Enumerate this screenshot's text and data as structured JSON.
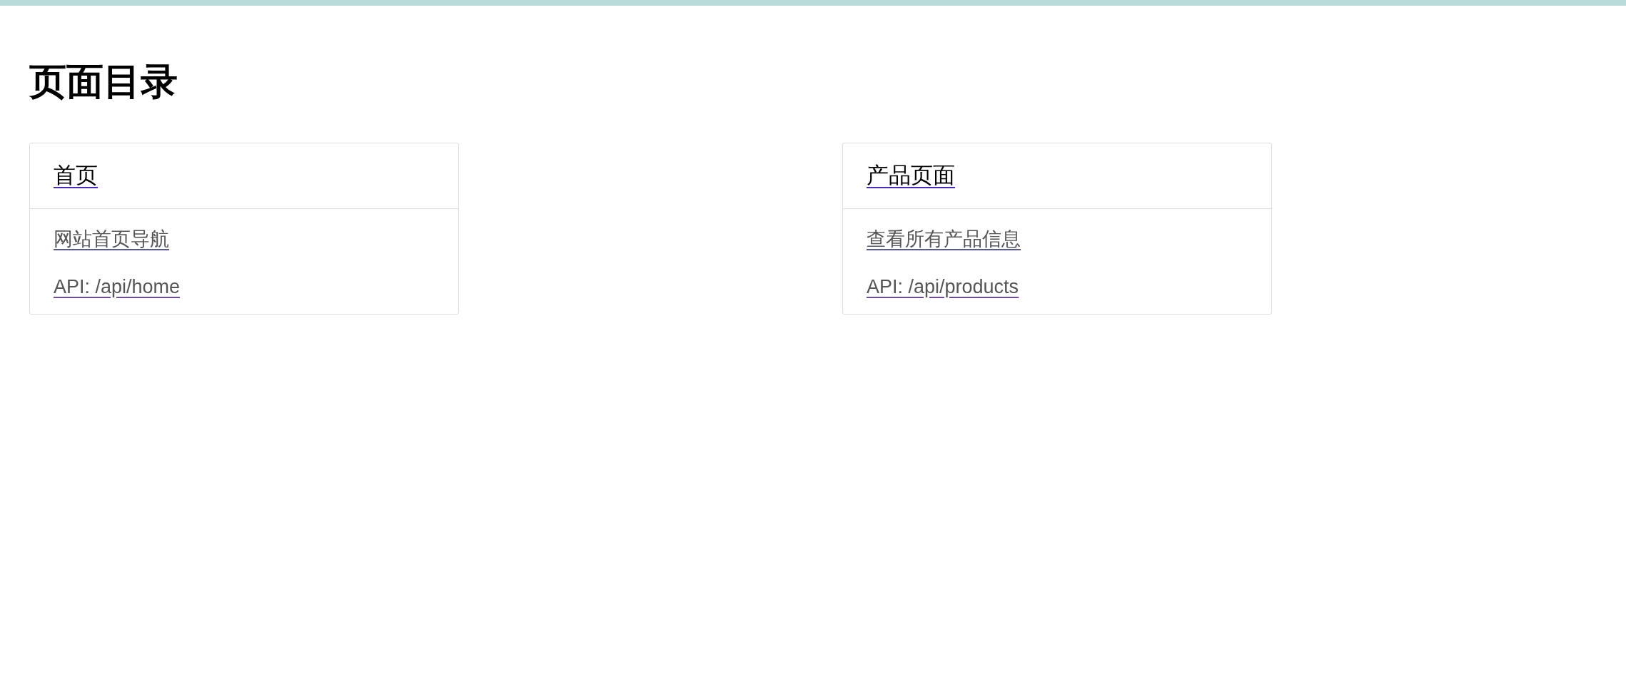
{
  "title": "页面目录",
  "cards": [
    {
      "title": "首页",
      "description": "网站首页导航",
      "api": "API: /api/home"
    },
    {
      "title": "产品页面",
      "description": "查看所有产品信息",
      "api": "API: /api/products"
    }
  ]
}
